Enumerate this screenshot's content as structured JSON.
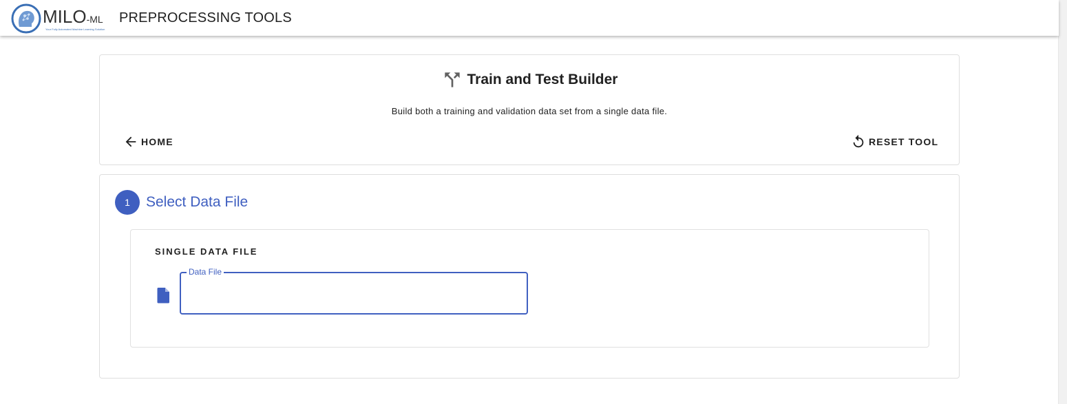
{
  "app_bar": {
    "logo_text": "MILO",
    "logo_suffix": "-ML",
    "logo_tagline": "Your Fully Automated Machine Learning Solution",
    "title": "PREPROCESSING TOOLS"
  },
  "header_card": {
    "title": "Train and Test Builder",
    "subtitle": "Build both a training and validation data set from a single data file.",
    "home_label": "HOME",
    "reset_label": "RESET TOOL",
    "icons": {
      "title": "call-split-icon",
      "home": "arrow-left-icon",
      "reset": "reset-icon"
    }
  },
  "step": {
    "number": "1",
    "label": "Select Data File",
    "panel": {
      "title": "SINGLE DATA FILE",
      "field_label": "Data File",
      "field_value": "",
      "icon": "file-icon"
    }
  },
  "colors": {
    "primary": "#3f5fc0",
    "text": "#212121",
    "border": "#dedede"
  }
}
